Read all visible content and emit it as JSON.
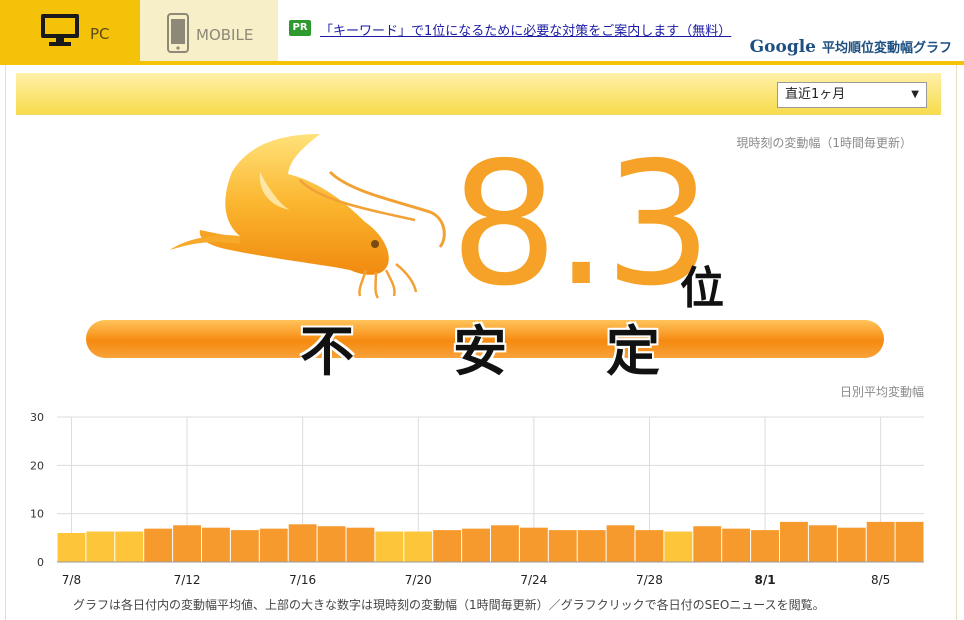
{
  "header": {
    "tabs": [
      {
        "label": "PC",
        "icon": "desktop-monitor-icon",
        "active": true
      },
      {
        "label": "MOBILE",
        "icon": "smartphone-icon",
        "active": false
      }
    ],
    "pr_badge": "PR",
    "pr_link": "「キーワード」で1位になるために必要な対策をご案内します（無料）",
    "brand_google": "Google",
    "brand_title": "平均順位変動幅グラフ"
  },
  "controls": {
    "period_select": "直近1ヶ月"
  },
  "current": {
    "caption": "現時刻の変動幅（1時間毎更新）",
    "value": "8.3",
    "unit": "位",
    "status": [
      "不",
      "安",
      "定"
    ]
  },
  "daily_caption": "日別平均変動幅",
  "footnote": "グラフは各日付内の変動幅平均値、上部の大きな数字は現時刻の変動幅（1時間毎更新）／グラフクリックで各日付のSEOニュースを閲覧。",
  "colors": {
    "accent": "#f5c20a",
    "bar_dark": "#f79a2e",
    "bar_light": "#fcc53a"
  },
  "chart_data": {
    "type": "bar",
    "ylim": [
      0,
      30
    ],
    "yticks": [
      0,
      10,
      20,
      30
    ],
    "xtick_labels": [
      "7/8",
      "7/12",
      "7/16",
      "7/20",
      "7/24",
      "7/28",
      "8/1",
      "8/5"
    ],
    "bold_tick": "8/1",
    "categories": [
      "7/8",
      "7/9",
      "7/10",
      "7/11",
      "7/12",
      "7/13",
      "7/14",
      "7/15",
      "7/16",
      "7/17",
      "7/18",
      "7/19",
      "7/20",
      "7/21",
      "7/22",
      "7/23",
      "7/24",
      "7/25",
      "7/26",
      "7/27",
      "7/28",
      "7/29",
      "7/30",
      "7/31",
      "8/1",
      "8/2",
      "8/3",
      "8/4",
      "8/5",
      "8/6"
    ],
    "values": [
      6.0,
      6.3,
      6.3,
      6.9,
      7.6,
      7.1,
      6.6,
      6.9,
      7.8,
      7.4,
      7.1,
      6.3,
      6.3,
      6.6,
      6.9,
      7.6,
      7.1,
      6.6,
      6.6,
      7.6,
      6.6,
      6.3,
      7.4,
      6.9,
      6.6,
      8.3,
      7.6,
      7.1,
      8.3,
      8.3
    ],
    "shade": [
      "light",
      "light",
      "light",
      "dark",
      "dark",
      "dark",
      "dark",
      "dark",
      "dark",
      "dark",
      "dark",
      "light",
      "light",
      "dark",
      "dark",
      "dark",
      "dark",
      "dark",
      "dark",
      "dark",
      "dark",
      "light",
      "dark",
      "dark",
      "dark",
      "dark",
      "dark",
      "dark",
      "dark",
      "dark"
    ]
  }
}
